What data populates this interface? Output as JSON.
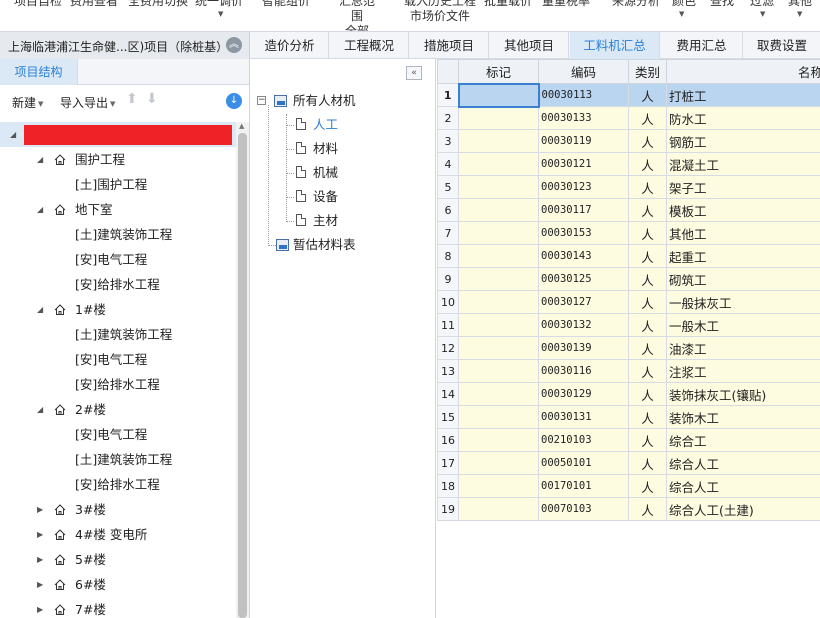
{
  "ribbon": {
    "items": [
      "项目自检",
      "费用查看",
      "全费用切换",
      "统一调价",
      "智能组价",
      "汇总范围\n全部",
      "载入历史工程\n市场价文件",
      "批量载价",
      "量重税率",
      "来源分析",
      "颜色",
      "查找",
      "过滤",
      "其他"
    ]
  },
  "tabbar": {
    "project_title": "上海临港浦江生命健...区)项目（除桩基）",
    "tabs": [
      "造价分析",
      "工程概况",
      "措施项目",
      "其他项目",
      "工料机汇总",
      "费用汇总",
      "取费设置"
    ],
    "active_tab": "工料机汇总"
  },
  "left": {
    "subtab": "项目结构",
    "toolbar": {
      "new_label": "新建",
      "io_label": "导入导出"
    },
    "tree": [
      {
        "label": "",
        "level": 0,
        "type": "root",
        "expanded": true,
        "redacted": true
      },
      {
        "label": "围护工程",
        "level": 1,
        "type": "group",
        "expanded": true
      },
      {
        "label": "[土]围护工程",
        "level": 2,
        "type": "leaf"
      },
      {
        "label": "地下室",
        "level": 1,
        "type": "group",
        "expanded": true
      },
      {
        "label": "[土]建筑装饰工程",
        "level": 2,
        "type": "leaf"
      },
      {
        "label": "[安]电气工程",
        "level": 2,
        "type": "leaf"
      },
      {
        "label": "[安]给排水工程",
        "level": 2,
        "type": "leaf"
      },
      {
        "label": "1#楼",
        "level": 1,
        "type": "group",
        "expanded": true
      },
      {
        "label": "[土]建筑装饰工程",
        "level": 2,
        "type": "leaf"
      },
      {
        "label": "[安]电气工程",
        "level": 2,
        "type": "leaf"
      },
      {
        "label": "[安]给排水工程",
        "level": 2,
        "type": "leaf"
      },
      {
        "label": "2#楼",
        "level": 1,
        "type": "group",
        "expanded": true
      },
      {
        "label": "[安]电气工程",
        "level": 2,
        "type": "leaf"
      },
      {
        "label": "[土]建筑装饰工程",
        "level": 2,
        "type": "leaf"
      },
      {
        "label": "[安]给排水工程",
        "level": 2,
        "type": "leaf"
      },
      {
        "label": "3#楼",
        "level": 1,
        "type": "group",
        "expanded": false
      },
      {
        "label": "4#楼 变电所",
        "level": 1,
        "type": "group",
        "expanded": false
      },
      {
        "label": "5#楼",
        "level": 1,
        "type": "group",
        "expanded": false
      },
      {
        "label": "6#楼",
        "level": 1,
        "type": "group",
        "expanded": false
      },
      {
        "label": "7#楼",
        "level": 1,
        "type": "group",
        "expanded": false
      }
    ]
  },
  "mid": {
    "root": "所有人材机",
    "children": [
      "人工",
      "材料",
      "机械",
      "设备",
      "主材"
    ],
    "selected_child": "人工",
    "extra": "暂估材料表"
  },
  "grid": {
    "columns": [
      "",
      "标记",
      "编码",
      "类别",
      "名称"
    ],
    "rows": [
      {
        "n": "1",
        "mark": "",
        "code": "00030113",
        "cat": "人",
        "name": "打桩工"
      },
      {
        "n": "2",
        "mark": "",
        "code": "00030133",
        "cat": "人",
        "name": "防水工"
      },
      {
        "n": "3",
        "mark": "",
        "code": "00030119",
        "cat": "人",
        "name": "钢筋工"
      },
      {
        "n": "4",
        "mark": "",
        "code": "00030121",
        "cat": "人",
        "name": "混凝土工"
      },
      {
        "n": "5",
        "mark": "",
        "code": "00030123",
        "cat": "人",
        "name": "架子工"
      },
      {
        "n": "6",
        "mark": "",
        "code": "00030117",
        "cat": "人",
        "name": "模板工"
      },
      {
        "n": "7",
        "mark": "",
        "code": "00030153",
        "cat": "人",
        "name": "其他工"
      },
      {
        "n": "8",
        "mark": "",
        "code": "00030143",
        "cat": "人",
        "name": "起重工"
      },
      {
        "n": "9",
        "mark": "",
        "code": "00030125",
        "cat": "人",
        "name": "砌筑工"
      },
      {
        "n": "10",
        "mark": "",
        "code": "00030127",
        "cat": "人",
        "name": "一般抹灰工"
      },
      {
        "n": "11",
        "mark": "",
        "code": "00030132",
        "cat": "人",
        "name": "一般木工"
      },
      {
        "n": "12",
        "mark": "",
        "code": "00030139",
        "cat": "人",
        "name": "油漆工"
      },
      {
        "n": "13",
        "mark": "",
        "code": "00030116",
        "cat": "人",
        "name": "注浆工"
      },
      {
        "n": "14",
        "mark": "",
        "code": "00030129",
        "cat": "人",
        "name": "装饰抹灰工(镶贴)"
      },
      {
        "n": "15",
        "mark": "",
        "code": "00030131",
        "cat": "人",
        "name": "装饰木工"
      },
      {
        "n": "16",
        "mark": "",
        "code": "00210103",
        "cat": "人",
        "name": "综合工"
      },
      {
        "n": "17",
        "mark": "",
        "code": "00050101",
        "cat": "人",
        "name": "综合人工"
      },
      {
        "n": "18",
        "mark": "",
        "code": "00170101",
        "cat": "人",
        "name": "综合人工"
      },
      {
        "n": "19",
        "mark": "",
        "code": "00070103",
        "cat": "人",
        "name": "综合人工(土建)"
      }
    ],
    "selected_row": "1"
  },
  "colors": {
    "accent": "#2a7fd4",
    "active_tab_bg": "#dbe9f7",
    "cell_bg": "#fdfbe0",
    "selected_cell": "#b9d5f0",
    "redaction": "#ef2228"
  }
}
